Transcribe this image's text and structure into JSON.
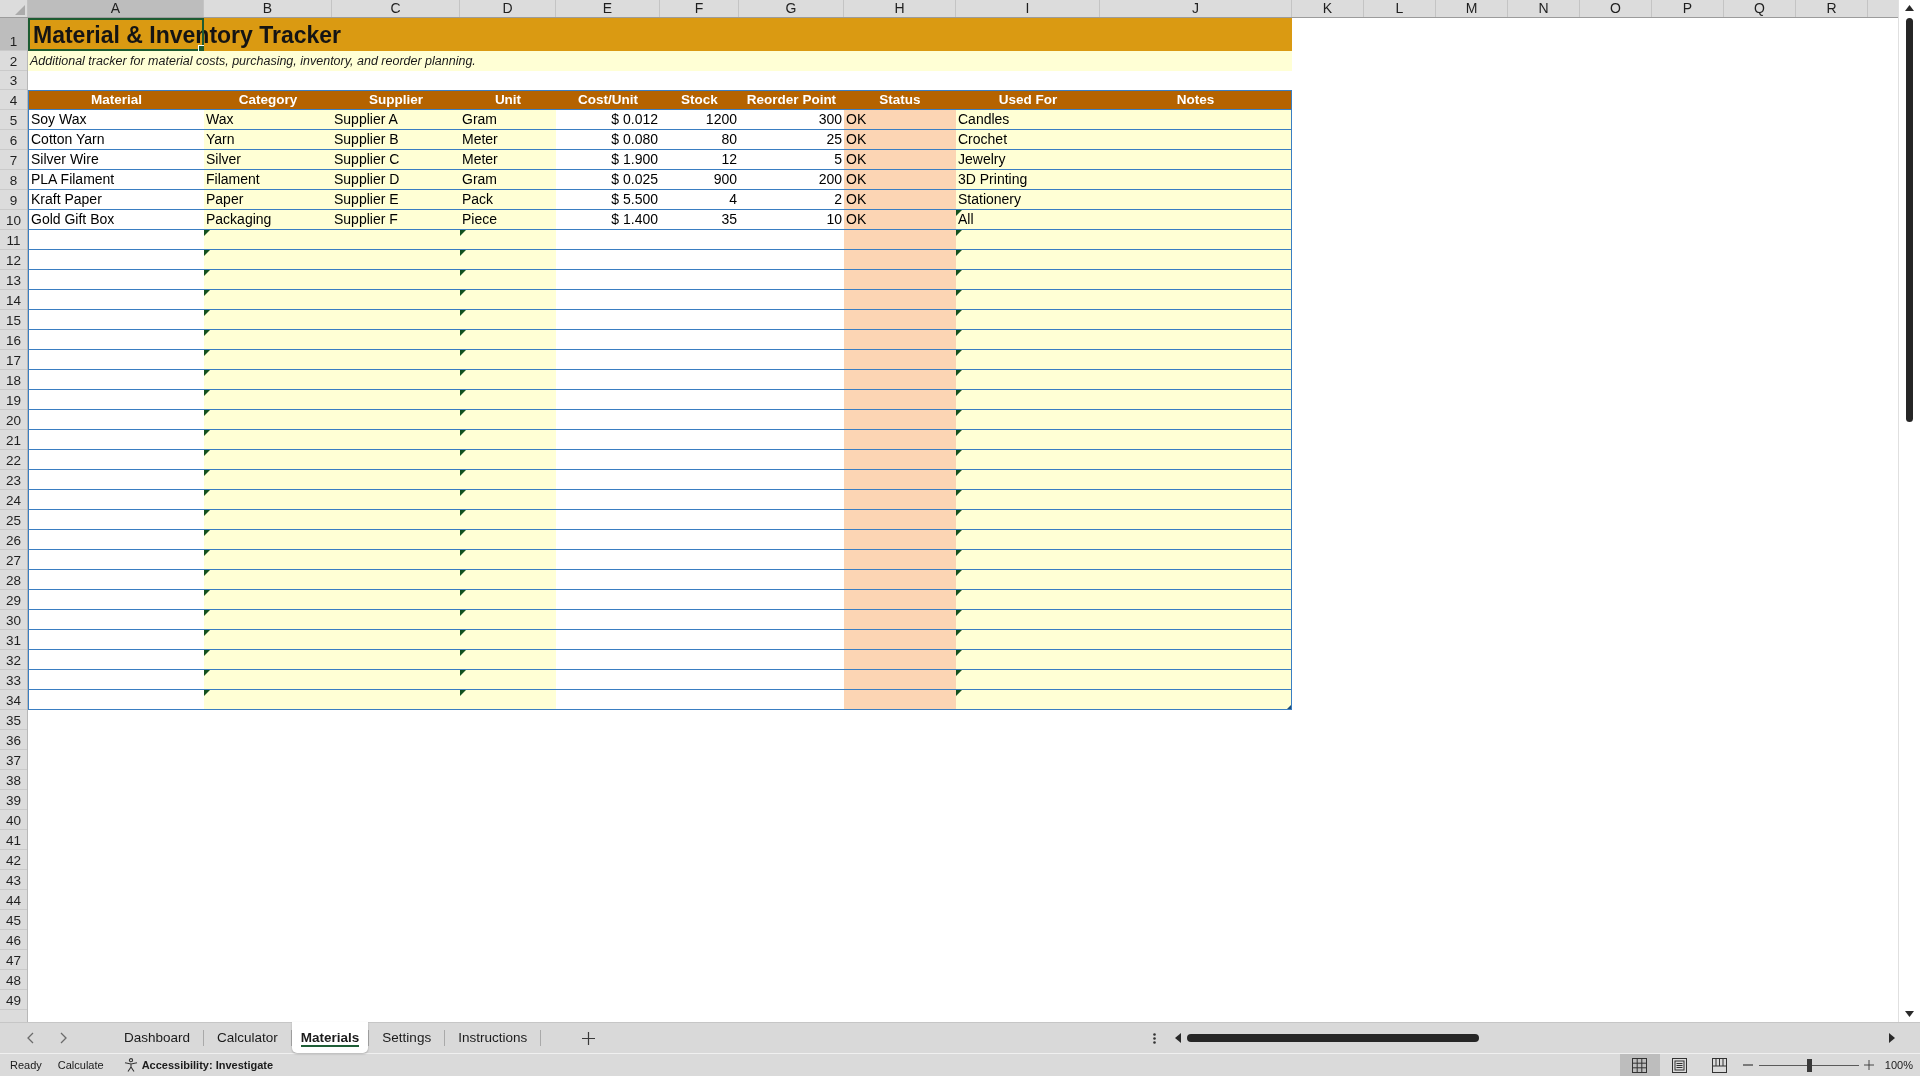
{
  "column_headers": [
    {
      "label": "A",
      "selected": true
    },
    {
      "label": "B",
      "selected": false
    },
    {
      "label": "C",
      "selected": false
    },
    {
      "label": "D",
      "selected": false
    },
    {
      "label": "E",
      "selected": false
    },
    {
      "label": "F",
      "selected": false
    },
    {
      "label": "G",
      "selected": false
    },
    {
      "label": "H",
      "selected": false
    },
    {
      "label": "I",
      "selected": false
    },
    {
      "label": "J",
      "selected": false
    },
    {
      "label": "K",
      "selected": false
    },
    {
      "label": "L",
      "selected": false
    },
    {
      "label": "M",
      "selected": false
    },
    {
      "label": "N",
      "selected": false
    },
    {
      "label": "O",
      "selected": false
    },
    {
      "label": "P",
      "selected": false
    },
    {
      "label": "Q",
      "selected": false
    },
    {
      "label": "R",
      "selected": false
    }
  ],
  "row_headers": [
    {
      "label": "1",
      "selected": true
    },
    {
      "label": "2",
      "selected": false
    },
    {
      "label": "3",
      "selected": false
    },
    {
      "label": "4",
      "selected": false
    },
    {
      "label": "5",
      "selected": false
    },
    {
      "label": "6",
      "selected": false
    },
    {
      "label": "7",
      "selected": false
    },
    {
      "label": "8",
      "selected": false
    },
    {
      "label": "9",
      "selected": false
    },
    {
      "label": "10",
      "selected": false
    },
    {
      "label": "11",
      "selected": false
    },
    {
      "label": "12",
      "selected": false
    },
    {
      "label": "13",
      "selected": false
    },
    {
      "label": "14",
      "selected": false
    },
    {
      "label": "15",
      "selected": false
    },
    {
      "label": "16",
      "selected": false
    },
    {
      "label": "17",
      "selected": false
    },
    {
      "label": "18",
      "selected": false
    },
    {
      "label": "19",
      "selected": false
    },
    {
      "label": "20",
      "selected": false
    },
    {
      "label": "21",
      "selected": false
    },
    {
      "label": "22",
      "selected": false
    },
    {
      "label": "23",
      "selected": false
    },
    {
      "label": "24",
      "selected": false
    },
    {
      "label": "25",
      "selected": false
    },
    {
      "label": "26",
      "selected": false
    },
    {
      "label": "27",
      "selected": false
    },
    {
      "label": "28",
      "selected": false
    },
    {
      "label": "29",
      "selected": false
    },
    {
      "label": "30",
      "selected": false
    },
    {
      "label": "31",
      "selected": false
    },
    {
      "label": "32",
      "selected": false
    },
    {
      "label": "33",
      "selected": false
    },
    {
      "label": "34",
      "selected": false
    },
    {
      "label": "35",
      "selected": false
    },
    {
      "label": "36",
      "selected": false
    },
    {
      "label": "37",
      "selected": false
    },
    {
      "label": "38",
      "selected": false
    },
    {
      "label": "39",
      "selected": false
    },
    {
      "label": "40",
      "selected": false
    },
    {
      "label": "41",
      "selected": false
    },
    {
      "label": "42",
      "selected": false
    },
    {
      "label": "43",
      "selected": false
    },
    {
      "label": "44",
      "selected": false
    },
    {
      "label": "45",
      "selected": false
    },
    {
      "label": "46",
      "selected": false
    },
    {
      "label": "47",
      "selected": false
    },
    {
      "label": "48",
      "selected": false
    },
    {
      "label": "49",
      "selected": false
    }
  ],
  "title": {
    "text": "Material & Inventory Tracker",
    "selected": true
  },
  "subtitle": "Additional tracker for material costs, purchasing, inventory, and reorder planning.",
  "table": {
    "columns": [
      "Material",
      "Category",
      "Supplier",
      "Unit",
      "Cost/Unit",
      "Stock",
      "Reorder Point",
      "Status",
      "Used For",
      "Notes"
    ],
    "rows": [
      {
        "material": "Soy Wax",
        "category": "Wax",
        "supplier": "Supplier A",
        "unit": "Gram",
        "cost_per_unit": "$ 0.012",
        "stock": "1200",
        "reorder_point": "300",
        "status": "OK",
        "used_for": "Candles",
        "warnings": {
          "category": false,
          "unit": false,
          "used_for": false
        }
      },
      {
        "material": "Cotton Yarn",
        "category": "Yarn",
        "supplier": "Supplier B",
        "unit": "Meter",
        "cost_per_unit": "$ 0.080",
        "stock": "80",
        "reorder_point": "25",
        "status": "OK",
        "used_for": "Crochet",
        "warnings": {
          "category": false,
          "unit": false,
          "used_for": false
        }
      },
      {
        "material": "Silver Wire",
        "category": "Silver",
        "supplier": "Supplier C",
        "unit": "Meter",
        "cost_per_unit": "$ 1.900",
        "stock": "12",
        "reorder_point": "5",
        "status": "OK",
        "used_for": "Jewelry",
        "warnings": {
          "category": false,
          "unit": false,
          "used_for": false
        }
      },
      {
        "material": "PLA Filament",
        "category": "Filament",
        "supplier": "Supplier D",
        "unit": "Gram",
        "cost_per_unit": "$ 0.025",
        "stock": "900",
        "reorder_point": "200",
        "status": "OK",
        "used_for": "3D Printing",
        "warnings": {
          "category": false,
          "unit": false,
          "used_for": false
        }
      },
      {
        "material": "Kraft Paper",
        "category": "Paper",
        "supplier": "Supplier E",
        "unit": "Pack",
        "cost_per_unit": "$ 5.500",
        "stock": "4",
        "reorder_point": "2",
        "status": "OK",
        "used_for": "Stationery",
        "warnings": {
          "category": false,
          "unit": false,
          "used_for": false
        }
      },
      {
        "material": "Gold Gift Box",
        "category": "Packaging",
        "supplier": "Supplier F",
        "unit": "Piece",
        "cost_per_unit": "$ 1.400",
        "stock": "35",
        "reorder_point": "10",
        "status": "OK",
        "used_for": "All",
        "warnings": {
          "category": false,
          "unit": false,
          "used_for": true
        }
      },
      {
        "warnings": {
          "category": true,
          "unit": true,
          "used_for": true
        }
      },
      {
        "warnings": {
          "category": true,
          "unit": true,
          "used_for": true
        }
      },
      {
        "warnings": {
          "category": true,
          "unit": true,
          "used_for": true
        }
      },
      {
        "warnings": {
          "category": true,
          "unit": true,
          "used_for": true
        }
      },
      {
        "warnings": {
          "category": true,
          "unit": true,
          "used_for": true
        }
      },
      {
        "warnings": {
          "category": true,
          "unit": true,
          "used_for": true
        }
      },
      {
        "warnings": {
          "category": true,
          "unit": true,
          "used_for": true
        }
      },
      {
        "warnings": {
          "category": true,
          "unit": true,
          "used_for": true
        }
      },
      {
        "warnings": {
          "category": true,
          "unit": true,
          "used_for": true
        }
      },
      {
        "warnings": {
          "category": true,
          "unit": true,
          "used_for": true
        }
      },
      {
        "warnings": {
          "category": true,
          "unit": true,
          "used_for": true
        }
      },
      {
        "warnings": {
          "category": true,
          "unit": true,
          "used_for": true
        }
      },
      {
        "warnings": {
          "category": true,
          "unit": true,
          "used_for": true
        }
      },
      {
        "warnings": {
          "category": true,
          "unit": true,
          "used_for": true
        }
      },
      {
        "warnings": {
          "category": true,
          "unit": true,
          "used_for": true
        }
      },
      {
        "warnings": {
          "category": true,
          "unit": true,
          "used_for": true
        }
      },
      {
        "warnings": {
          "category": true,
          "unit": true,
          "used_for": true
        }
      },
      {
        "warnings": {
          "category": true,
          "unit": true,
          "used_for": true
        }
      },
      {
        "warnings": {
          "category": true,
          "unit": true,
          "used_for": true
        }
      },
      {
        "warnings": {
          "category": true,
          "unit": true,
          "used_for": true
        }
      },
      {
        "warnings": {
          "category": true,
          "unit": true,
          "used_for": true
        }
      },
      {
        "warnings": {
          "category": true,
          "unit": true,
          "used_for": true
        }
      },
      {
        "warnings": {
          "category": true,
          "unit": true,
          "used_for": true
        }
      },
      {
        "warnings": {
          "category": true,
          "unit": true,
          "used_for": true
        }
      }
    ]
  },
  "sheet_tabs": [
    {
      "label": "Dashboard",
      "selected": false
    },
    {
      "label": "Calculator",
      "selected": false
    },
    {
      "label": "Materials",
      "selected": true
    },
    {
      "label": "Settings",
      "selected": false
    },
    {
      "label": "Instructions",
      "selected": false
    }
  ],
  "status_bar": {
    "mode": "Ready",
    "calculate": "Calculate",
    "accessibility": "Accessibility: Investigate",
    "views": [
      {
        "kind": "normal",
        "selected": true
      },
      {
        "kind": "page_layout",
        "selected": false
      },
      {
        "kind": "page_break",
        "selected": false
      }
    ],
    "zoom": {
      "level": 0.5,
      "reading": "100%"
    }
  }
}
